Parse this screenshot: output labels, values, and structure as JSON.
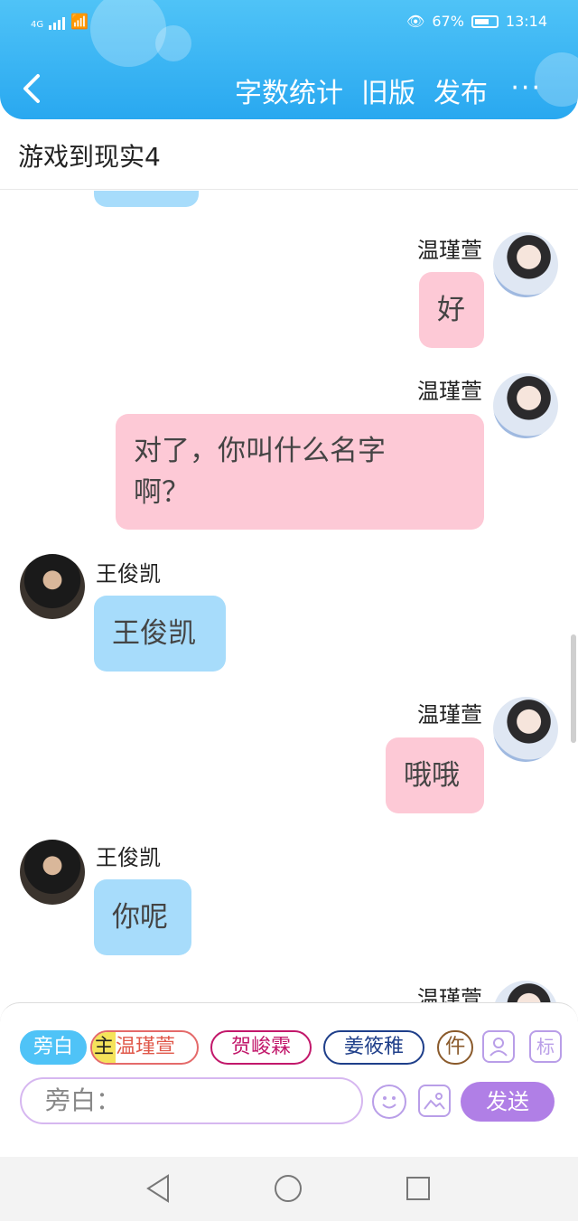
{
  "status": {
    "network": "4G",
    "battery": "67%",
    "time": "13:14"
  },
  "header": {
    "actions": [
      "字数统计",
      "旧版",
      "发布"
    ],
    "more": "···"
  },
  "page_title": "游戏到现实4",
  "messages": [
    {
      "side": "right",
      "name": "温瑾萱",
      "text": "好"
    },
    {
      "side": "right",
      "name": "温瑾萱",
      "text_lines": [
        "对了，你叫什么名字",
        "啊？"
      ]
    },
    {
      "side": "left",
      "name": "王俊凯",
      "text": "王俊凯"
    },
    {
      "side": "right",
      "name": "温瑾萱",
      "text": "哦哦"
    },
    {
      "side": "left",
      "name": "王俊凯",
      "text": "你呢"
    },
    {
      "side": "right",
      "name": "温瑾萱",
      "text": ""
    }
  ],
  "roles": {
    "narration": "旁白",
    "main_tag": "主",
    "main": "温瑾萱",
    "role2": "贺峻霖",
    "role3": "姜筱稚",
    "role4": "仵"
  },
  "toolbar": {
    "tag_label": "标"
  },
  "input": {
    "placeholder": "旁白："
  },
  "send_label": "发送",
  "colors": {
    "header": "#29a8f0",
    "pink_bubble": "#fdc9d6",
    "blue_bubble": "#a7dcfb",
    "send": "#b07fe6"
  }
}
